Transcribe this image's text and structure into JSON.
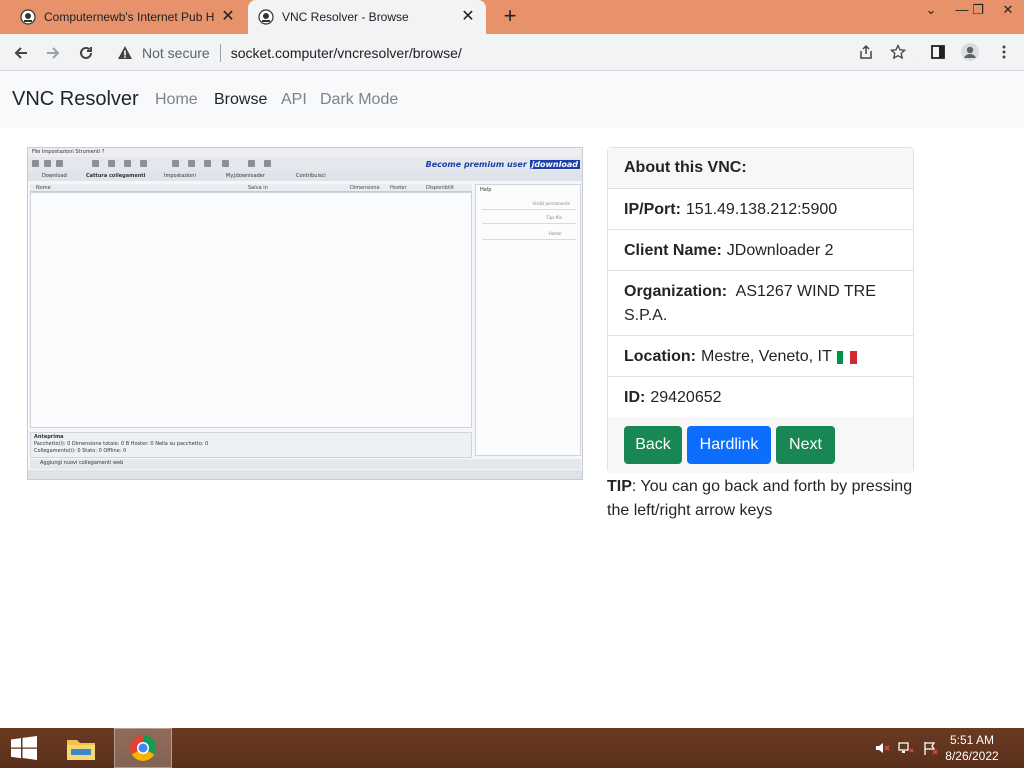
{
  "browser": {
    "tabs": [
      {
        "title": "Computernewb's Internet Pub H",
        "active": false
      },
      {
        "title": "VNC Resolver - Browse",
        "active": true
      }
    ],
    "address": {
      "security_label": "Not secure",
      "url": "socket.computer/vncresolver/browse/"
    },
    "tab_strip_color": "#e8926b"
  },
  "site": {
    "brand": "VNC Resolver",
    "nav": [
      "Home",
      "Browse",
      "API",
      "Dark Mode"
    ],
    "active_nav": "Browse"
  },
  "screenshot": {
    "menu_text": "File  Impostazioni  Strumenti  ?",
    "premium_text": "Become premium user",
    "premium_brand": "jdownload",
    "tabs": [
      "Download",
      "Cattura collegamenti",
      "Impostazioni",
      "My.Jdownloader",
      "Contribuisci"
    ],
    "columns": [
      "Nome",
      "Salva in",
      "Dimensione",
      "Hoster",
      "Disponibilit",
      "Help"
    ],
    "side_options": [
      "Visibil permanente",
      "Tipo file",
      "Hoster"
    ],
    "bottom_title": "Anteprima",
    "bottom_line1": "Pacchetto(i): 0  Dimensione totale: 0 B  Hoster: 0  Nella su pacchetto: 0",
    "bottom_line2": "Collegamento(i): 0  Stato: 0  Offline: 0",
    "add_links": "Aggiungi nuovi collegamenti web"
  },
  "card": {
    "header": "About this VNC:",
    "rows": [
      {
        "label": "IP/Port:",
        "value": "151.49.138.212:5900"
      },
      {
        "label": "Client Name:",
        "value": "JDownloader 2"
      },
      {
        "label": "Organization:",
        "value": "AS1267 WIND TRE S.P.A."
      },
      {
        "label": "Location:",
        "value": "Mestre, Veneto, IT"
      },
      {
        "label": "ID:",
        "value": "29420652"
      }
    ],
    "flag_colors": [
      "#009246",
      "#ffffff",
      "#ce2b37"
    ],
    "buttons": {
      "back": "Back",
      "hardlink": "Hardlink",
      "next": "Next"
    }
  },
  "tip": {
    "label": "TIP",
    "text": ": You can go back and forth by pressing the left/right arrow keys"
  },
  "taskbar": {
    "time": "5:51 AM",
    "date": "8/26/2022"
  }
}
